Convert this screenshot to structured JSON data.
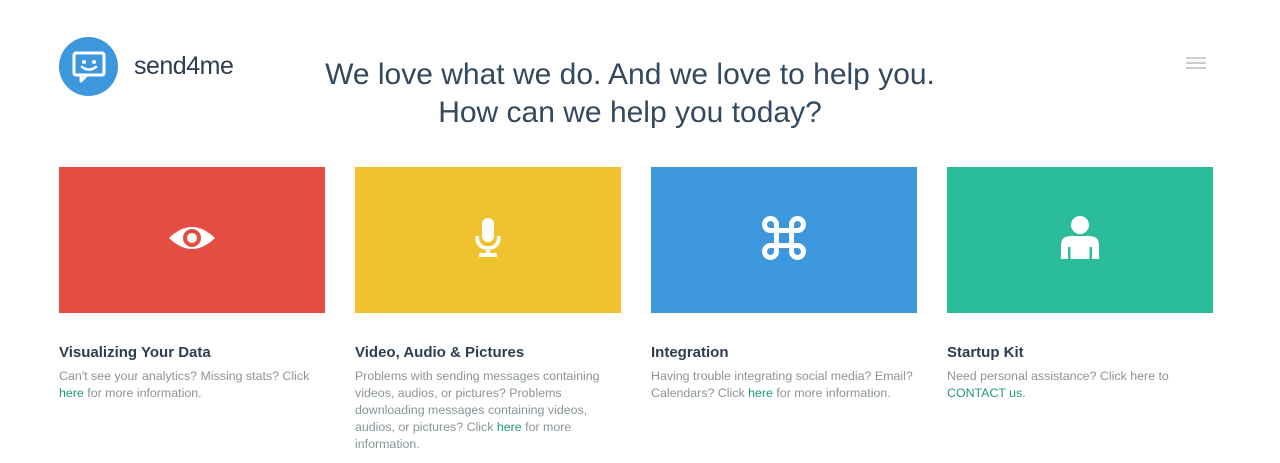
{
  "brand": {
    "name": "send4me"
  },
  "header": {
    "headline_line1": "We love what we do. And we love to help you.",
    "headline_line2": "How can we help you today?",
    "menu_icon": "hamburger-icon"
  },
  "colors": {
    "logo": "#3d97dc",
    "red": "#e54d42",
    "yellow": "#efc32f",
    "blue": "#3d97dc",
    "green": "#2bbc9b",
    "link": "#1e9b77"
  },
  "cards": [
    {
      "icon": "eye-icon",
      "title": "Visualizing Your Data",
      "text_before": "Can't see your analytics? Missing stats? Click ",
      "link": "here",
      "text_after": " for more information."
    },
    {
      "icon": "microphone-icon",
      "title": "Video, Audio & Pictures",
      "text_before": "Problems with sending messages containing videos, audios, or pictures? Problems downloading messages containing videos, audios, or pictures? Click ",
      "link": "here",
      "text_after": " for more information."
    },
    {
      "icon": "command-key-icon",
      "title": "Integration",
      "text_before": "Having trouble integrating social media? Email? Calendars? Click ",
      "link": "here",
      "text_after": " for more information."
    },
    {
      "icon": "person-icon",
      "title": "Startup Kit",
      "text_before": "Need personal assistance? Click here to ",
      "link": "CONTACT us.",
      "text_after": ""
    }
  ]
}
